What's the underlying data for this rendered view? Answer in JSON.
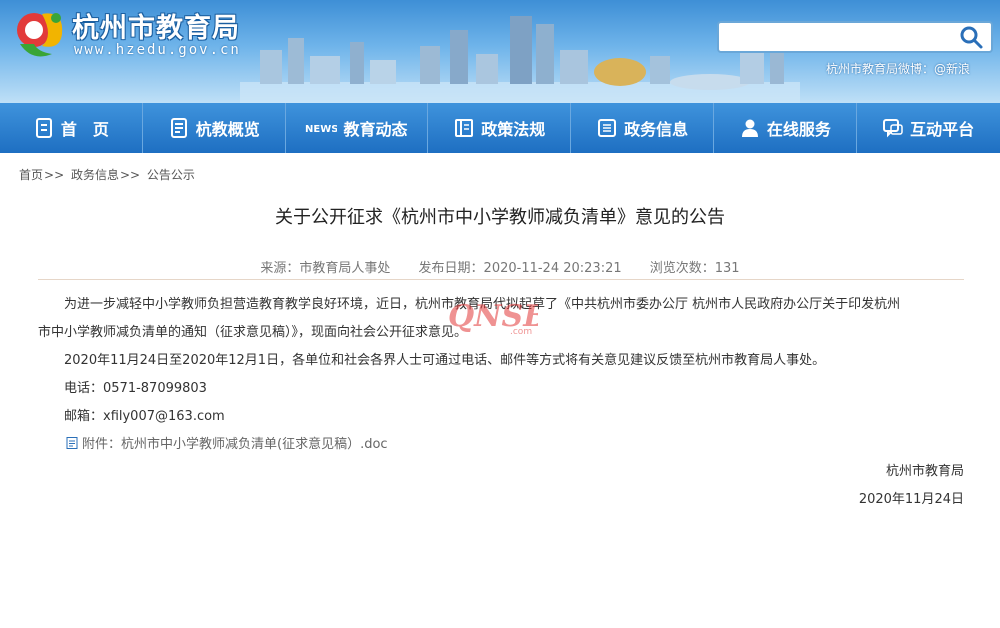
{
  "header": {
    "site_name": "杭州市教育局",
    "site_url": "www.hzedu.gov.cn",
    "search_placeholder": "",
    "weibo_text": "杭州市教育局微博：@新浪"
  },
  "nav": {
    "items": [
      {
        "label": "首　页",
        "icon": "document-icon"
      },
      {
        "label": "杭教概览",
        "icon": "list-icon"
      },
      {
        "label": "教育动态",
        "icon": "news-icon"
      },
      {
        "label": "政策法规",
        "icon": "book-icon"
      },
      {
        "label": "政务信息",
        "icon": "info-icon"
      },
      {
        "label": "在线服务",
        "icon": "person-icon"
      },
      {
        "label": "互动平台",
        "icon": "chat-icon"
      }
    ]
  },
  "breadcrumb": {
    "items": [
      "首页",
      "政务信息",
      "公告公示"
    ],
    "separator": ">>"
  },
  "article": {
    "title": "关于公开征求《杭州市中小学教师减负清单》意见的公告",
    "source": "来源：市教育局人事处",
    "date": "发布日期：2020-11-24 20:23:21",
    "views": "浏览次数：131",
    "para1_line1": "为进一步减轻中小学教师负担营造教育教学良好环境，近日，杭州市教育局代拟起草了《中共杭州市委办公厅 杭州市人民政府办公厅关于印发杭州",
    "para1_line2": "市中小学教师减负清单的通知（征求意见稿）》，现面向社会公开征求意见。",
    "para2": "2020年11月24日至2020年12月1日，各单位和社会各界人士可通过电话、邮件等方式将有关意见建议反馈至杭州市教育局人事处。",
    "phone": "电话：0571-87099803",
    "email": "邮箱：xfily007@163.com",
    "attachment": "附件：杭州市中小学教师减负清单(征求意见稿）.doc",
    "sign_org": "杭州市教育局",
    "sign_date": "2020年11月24日"
  },
  "watermark": {
    "text": "QNSB",
    "suffix": ".com"
  },
  "colors": {
    "nav_top": "#3f93dc",
    "nav_bottom": "#1e6fc2",
    "header_sky": "#6fb4ea",
    "watermark": "#e23a3a"
  }
}
